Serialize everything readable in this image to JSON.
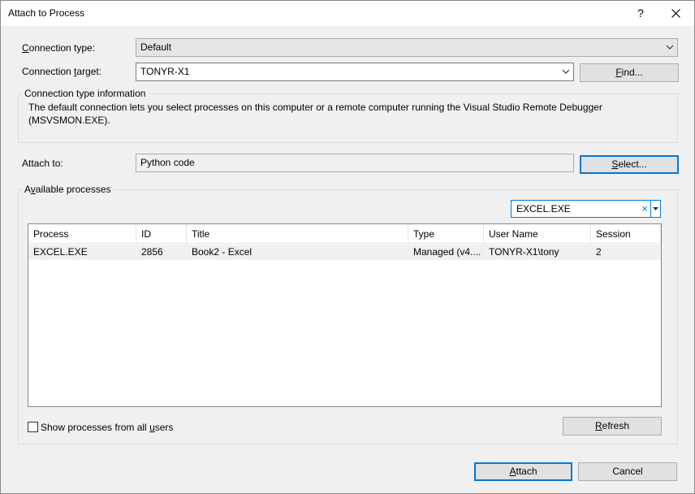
{
  "window": {
    "title": "Attach to Process",
    "help": "?"
  },
  "connection": {
    "type_label_prefix": "C",
    "type_label_rest": "onnection type:",
    "type_value": "Default",
    "target_label_prefix": "Connection ",
    "target_label_u": "t",
    "target_label_rest": "arget:",
    "target_value": "TONYR-X1",
    "find_label_u": "F",
    "find_label_rest": "ind..."
  },
  "info": {
    "title": "Connection type information",
    "line1": "The default connection lets you select processes on this computer or a remote computer running the Visual Studio Remote Debugger",
    "line2": "(MSVSMON.EXE)."
  },
  "attach_to": {
    "label": "Attach to:",
    "value": "Python code",
    "select_label_u": "S",
    "select_label_rest": "elect..."
  },
  "processes": {
    "title_prefix": "A",
    "title_u": "v",
    "title_rest": "ailable processes",
    "filter_value": "EXCEL.EXE",
    "filter_clear": "×",
    "columns": [
      "Process",
      "ID",
      "Title",
      "Type",
      "User Name",
      "Session"
    ],
    "rows": [
      [
        "EXCEL.EXE",
        "2856",
        "Book2 - Excel",
        "Managed (v4....",
        "TONYR-X1\\tony",
        "2"
      ]
    ],
    "show_all_prefix": "Show processes from all ",
    "show_all_u": "u",
    "show_all_rest": "sers",
    "show_all_checked": false,
    "refresh_u": "R",
    "refresh_rest": "efresh"
  },
  "footer": {
    "attach_u": "A",
    "attach_rest": "ttach",
    "cancel": "Cancel"
  }
}
